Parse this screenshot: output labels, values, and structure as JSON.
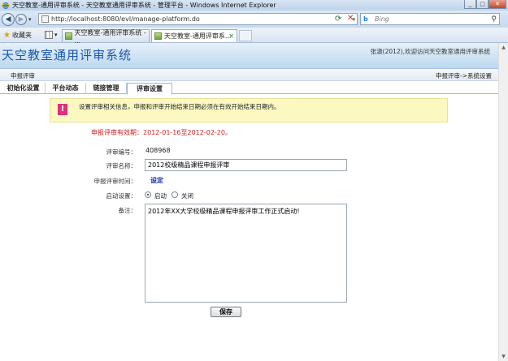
{
  "window": {
    "title": "天空教室-通用评审系统 - 天空教室通用评审系统 - 管理平台 - Windows Internet Explorer",
    "min": "_",
    "max": "□",
    "close": "✕"
  },
  "addressbar": {
    "url": "http://localhost:8080/evl/manage-platform.do",
    "search_placeholder": "Bing"
  },
  "favorites_label": "收藏夹",
  "browser_tabs": [
    {
      "label": "天空教室-通用评审系统 - ..."
    },
    {
      "label": "天空教室-通用评审系..."
    }
  ],
  "site": {
    "title": "天空教室通用评审系统",
    "welcome": "张潇(2012),欢迎访问天空教室通用评审系统"
  },
  "breadcrumb": {
    "left": "申报评审",
    "right": "申报评审->系统设置"
  },
  "nav_tabs": [
    "初始化设置",
    "平台动态",
    "链接管理",
    "评审设置"
  ],
  "notice": "设置评审相关信息，申报和评审开始结束日期必须在有效开始结束日期内。",
  "validity": "申报评审有效期：2012-01-16至2012-02-20。",
  "form": {
    "id_label": "评审编号：",
    "id_value": "408968",
    "name_label": "评审名称：",
    "name_value": "2012校级精品课程申报评审",
    "time_label": "申报评审时间：",
    "time_link": "设定",
    "start_label": "启动设置：",
    "start_on": "启动",
    "start_off": "关闭",
    "note_label": "备注：",
    "note_value": "2012年XX大学校级精品课程申报评审工作正式启动!",
    "save": "保存"
  }
}
